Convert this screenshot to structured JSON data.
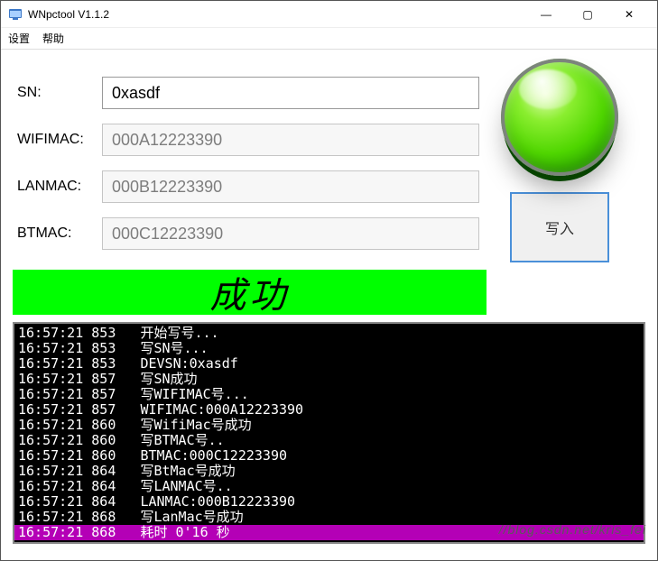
{
  "window": {
    "title": "WNpctool V1.1.2",
    "minimize": "—",
    "maximize": "▢",
    "close": "✕"
  },
  "menu": {
    "settings": "设置",
    "help": "帮助"
  },
  "form": {
    "sn_label": "SN:",
    "sn_value": "0xasdf",
    "wifimac_label": "WIFIMAC:",
    "wifimac_value": "000A12223390",
    "lanmac_label": "LANMAC:",
    "lanmac_value": "000B12223390",
    "btmac_label": "BTMAC:",
    "btmac_value": "000C12223390"
  },
  "buttons": {
    "write": "写入"
  },
  "status": {
    "banner": "成功"
  },
  "console": {
    "lines": [
      "16:57:21 853   开始写号...",
      "16:57:21 853   写SN号...",
      "16:57:21 853   DEVSN:0xasdf",
      "16:57:21 857   写SN成功",
      "16:57:21 857   写WIFIMAC号...",
      "16:57:21 857   WIFIMAC:000A12223390",
      "16:57:21 860   写WifiMac号成功",
      "16:57:21 860   写BTMAC号..",
      "16:57:21 860   BTMAC:000C12223390",
      "16:57:21 864   写BtMac号成功",
      "16:57:21 864   写LANMAC号..",
      "16:57:21 864   LANMAC:000B12223390",
      "16:57:21 868   写LanMac号成功",
      "16:57:21 868   耗时 0'16 秒"
    ],
    "highlight_index": 13
  },
  "watermark": "//blog.csdn.net/kris_fei"
}
